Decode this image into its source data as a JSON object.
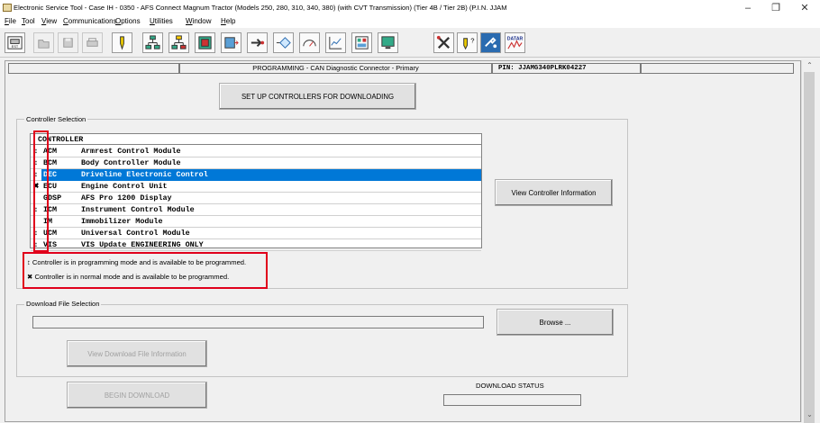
{
  "window": {
    "title": "Electronic Service Tool - Case IH - 0350 - AFS Connect Magnum Tractor (Models 250, 280, 310, 340, 380) (with CVT Transmission) (Tier 4B / Tier 2B) (P.I.N. JJAM",
    "controls": {
      "minimize": "–",
      "maximize": "❐",
      "close": "✕"
    }
  },
  "menu": [
    "File",
    "Tool",
    "View",
    "Communications",
    "Options",
    "Utilities",
    "Window",
    "Help"
  ],
  "toolbar": {
    "datar_label": "DATAR",
    "icons": [
      "est-icon",
      "open-icon",
      "save-icon",
      "print-icon",
      "connect-icon",
      "network-icon",
      "network-alt-icon",
      "module-icon",
      "flash-icon",
      "forward-icon",
      "diamond-icon",
      "meter-icon",
      "graph-icon",
      "controller-icon",
      "monitor-icon",
      "tools-icon",
      "help-icon",
      "settings-icon",
      "datar-icon"
    ]
  },
  "status": {
    "mode_text": "PROGRAMMING  -  CAN Diagnostic Connector - Primary",
    "pin_text": "PIN:  JJAMG340PLRK04227"
  },
  "setup_button": "SET UP CONTROLLERS FOR DOWNLOADING",
  "controller_selection": {
    "group_label": "Controller Selection",
    "header": "CONTROLLER",
    "rows": [
      {
        "status": "↕",
        "code": "ACM",
        "name": "Armrest Control Module",
        "selected": false
      },
      {
        "status": "↕",
        "code": "BCM",
        "name": "Body Controller Module",
        "selected": false
      },
      {
        "status": "↕",
        "code": "DEC",
        "name": "Driveline Electronic Control",
        "selected": true
      },
      {
        "status": "✖",
        "code": "ECU",
        "name": "Engine Control Unit",
        "selected": false
      },
      {
        "status": "",
        "code": "GDSP",
        "name": "AFS Pro 1200 Display",
        "selected": false
      },
      {
        "status": "↕",
        "code": "ICM",
        "name": "Instrument Control Module",
        "selected": false
      },
      {
        "status": "",
        "code": "IM",
        "name": "Immobilizer Module",
        "selected": false
      },
      {
        "status": "↕",
        "code": "UCM",
        "name": "Universal Control Module",
        "selected": false
      },
      {
        "status": "↕",
        "code": "VIS",
        "name": "VIS Update ENGINEERING ONLY",
        "selected": false
      }
    ],
    "view_info_button": "View Controller Information",
    "legend": [
      {
        "icon": "↕",
        "text": "Controller is in programming mode and is available to be programmed."
      },
      {
        "icon": "✖",
        "text": "Controller is in normal mode and is available to be programmed."
      }
    ]
  },
  "download_file": {
    "group_label": "Download File Selection",
    "file_path": "",
    "browse_button": "Browse ...",
    "view_info_button": "View Download File Information"
  },
  "begin_download_button": "BEGIN DOWNLOAD",
  "download_status_label": "DOWNLOAD STATUS",
  "scrollbar": {
    "up": "⌃",
    "down": "⌄"
  }
}
